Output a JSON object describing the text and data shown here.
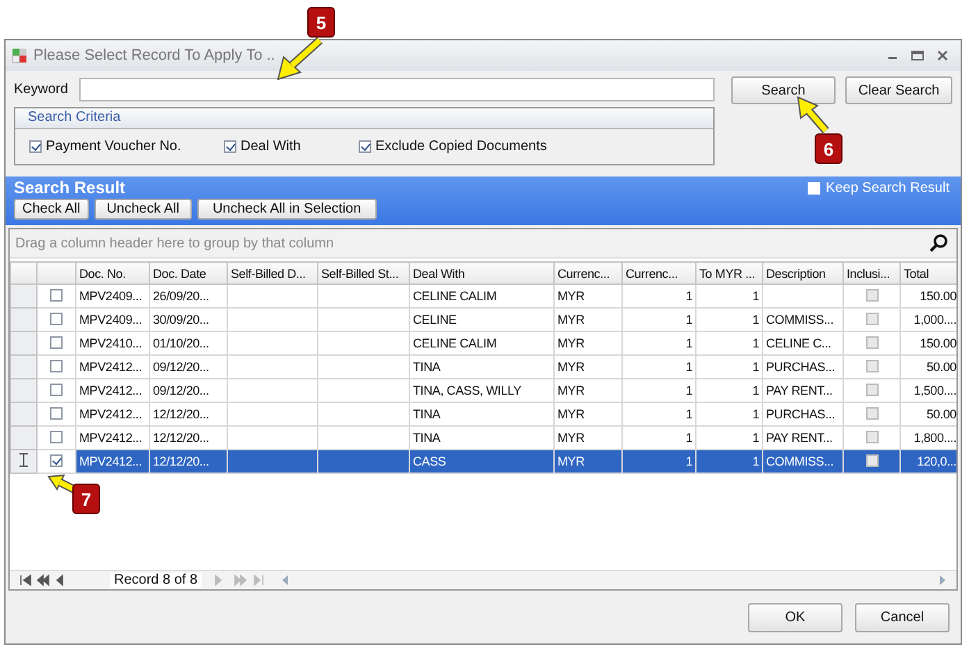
{
  "window": {
    "title": "Please Select Record To Apply To .."
  },
  "keyword": {
    "label": "Keyword"
  },
  "search_buttons": [
    "Search",
    "Clear Search"
  ],
  "criteria": {
    "title": "Search Criteria",
    "options": [
      {
        "label": "Payment Voucher No.",
        "checked": true
      },
      {
        "label": "Deal With",
        "checked": true
      },
      {
        "label": "Exclude Copied Documents",
        "checked": true
      }
    ]
  },
  "result": {
    "title": "Search Result",
    "keep": {
      "label": "Keep Search Result",
      "checked": false
    },
    "buttons": [
      "Check All",
      "Uncheck All",
      "Uncheck All in Selection"
    ],
    "group_hint": "Drag a column header here to group by that column"
  },
  "table": {
    "columns": [
      {
        "label": "Doc. No.",
        "kind": "text"
      },
      {
        "label": "Doc. Date",
        "kind": "text"
      },
      {
        "label": "Self-Billed D...",
        "kind": "text"
      },
      {
        "label": "Self-Billed St...",
        "kind": "text"
      },
      {
        "label": "Deal With",
        "kind": "text"
      },
      {
        "label": "Currenc...",
        "kind": "text"
      },
      {
        "label": "Currenc...",
        "kind": "number"
      },
      {
        "label": "To MYR ...",
        "kind": "number"
      },
      {
        "label": "Description",
        "kind": "text"
      },
      {
        "label": "Inclusi...",
        "kind": "check"
      },
      {
        "label": "Total",
        "kind": "number"
      }
    ],
    "rows": [
      {
        "selected": false,
        "checked": false,
        "cells": [
          "MPV2409...",
          "26/09/20...",
          null,
          null,
          "CELINE CALIM",
          "MYR",
          "1",
          "1",
          null,
          false,
          "150.00"
        ]
      },
      {
        "selected": false,
        "checked": false,
        "cells": [
          "MPV2409...",
          "30/09/20...",
          null,
          null,
          "CELINE",
          "MYR",
          "1",
          "1",
          "COMMISS...",
          false,
          "1,000...."
        ]
      },
      {
        "selected": false,
        "checked": false,
        "cells": [
          "MPV2410...",
          "01/10/20...",
          null,
          null,
          "CELINE CALIM",
          "MYR",
          "1",
          "1",
          "CELINE C...",
          false,
          "150.00"
        ]
      },
      {
        "selected": false,
        "checked": false,
        "cells": [
          "MPV2412...",
          "09/12/20...",
          null,
          null,
          "TINA",
          "MYR",
          "1",
          "1",
          "PURCHAS...",
          false,
          "50.00"
        ]
      },
      {
        "selected": false,
        "checked": false,
        "cells": [
          "MPV2412...",
          "09/12/20...",
          null,
          null,
          "TINA, CASS, WILLY",
          "MYR",
          "1",
          "1",
          "PAY RENT...",
          false,
          "1,500...."
        ]
      },
      {
        "selected": false,
        "checked": false,
        "cells": [
          "MPV2412...",
          "12/12/20...",
          null,
          null,
          "TINA",
          "MYR",
          "1",
          "1",
          "PURCHAS...",
          false,
          "50.00"
        ]
      },
      {
        "selected": false,
        "checked": false,
        "cells": [
          "MPV2412...",
          "12/12/20...",
          null,
          null,
          "TINA",
          "MYR",
          "1",
          "1",
          "PAY RENT...",
          false,
          "1,800...."
        ]
      },
      {
        "selected": true,
        "checked": true,
        "cells": [
          "MPV2412...",
          "12/12/20...",
          null,
          null,
          "CASS",
          "MYR",
          "1",
          "1",
          "COMMISS...",
          false,
          "120,0..."
        ]
      }
    ]
  },
  "navigator": {
    "text": "Record 8 of 8"
  },
  "buttons": [
    "OK",
    "Cancel"
  ],
  "callouts": [
    {
      "label": "5"
    },
    {
      "label": "6"
    },
    {
      "label": "7"
    }
  ]
}
